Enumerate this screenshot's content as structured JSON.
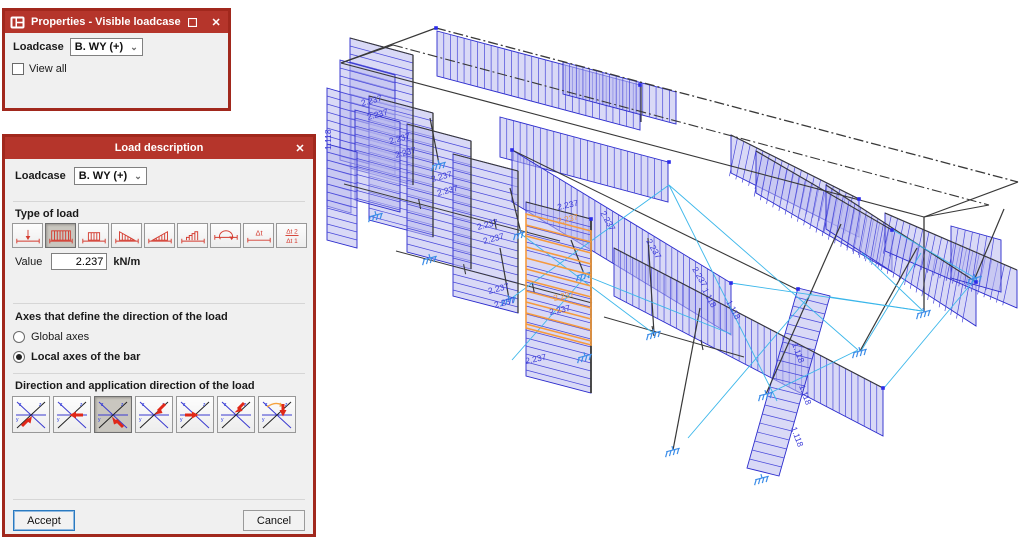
{
  "properties_window": {
    "title": "Properties - Visible loadcase",
    "maximize_glyph": "❐",
    "close_glyph": "✕",
    "loadcase_label": "Loadcase",
    "loadcase_value": "B. WY (+)",
    "view_all_label": "View all",
    "view_all_checked": false
  },
  "load_window": {
    "title": "Load description",
    "close_glyph": "✕",
    "loadcase_label": "Loadcase",
    "loadcase_value": "B. WY (+)",
    "type_of_load_label": "Type of load",
    "load_type_icons": [
      "point-load-icon",
      "uniform-load-icon",
      "partial-uniform-load-icon",
      "triangular-load-left-icon",
      "triangular-load-right-icon",
      "stepped-load-icon",
      "moment-load-icon",
      "delta-t-icon",
      "delta-t2-t1-icon"
    ],
    "selected_load_type_index": 1,
    "value_label": "Value",
    "value": "2.237",
    "unit": "kN/m",
    "axes_section_label": "Axes that define the direction of the load",
    "axes_options": [
      {
        "label": "Global axes",
        "selected": false
      },
      {
        "label": "Local axes of the bar",
        "selected": true
      }
    ],
    "direction_section_label": "Direction and application direction of the load",
    "direction_icons": [
      "axes-arrow-ne-icon",
      "axes-arrow-w-icon",
      "axes-arrow-nw-icon",
      "axes-arrow-sw-icon",
      "axes-arrow-e-icon",
      "axes-arrow-sw-steep-icon",
      "axes-arrow-down-rotation-icon"
    ],
    "selected_direction_index": 2,
    "accept_label": "Accept",
    "cancel_label": "Cancel",
    "delta_t_text": "Δt",
    "delta_t2_text": "Δt 2",
    "delta_t1_text": "Δt 1"
  },
  "model": {
    "primary_load_value": "2.237",
    "secondary_load_value": "1.118",
    "load_diagram_color": "#2a2acc",
    "load_fill_color": "#b9b9ee",
    "highlight_color": "#f59a3e",
    "bracing_color": "#3ab6ea",
    "frame_color": "#383838",
    "support_color": "#3c8de8",
    "label_color": "#3b3bd8"
  }
}
